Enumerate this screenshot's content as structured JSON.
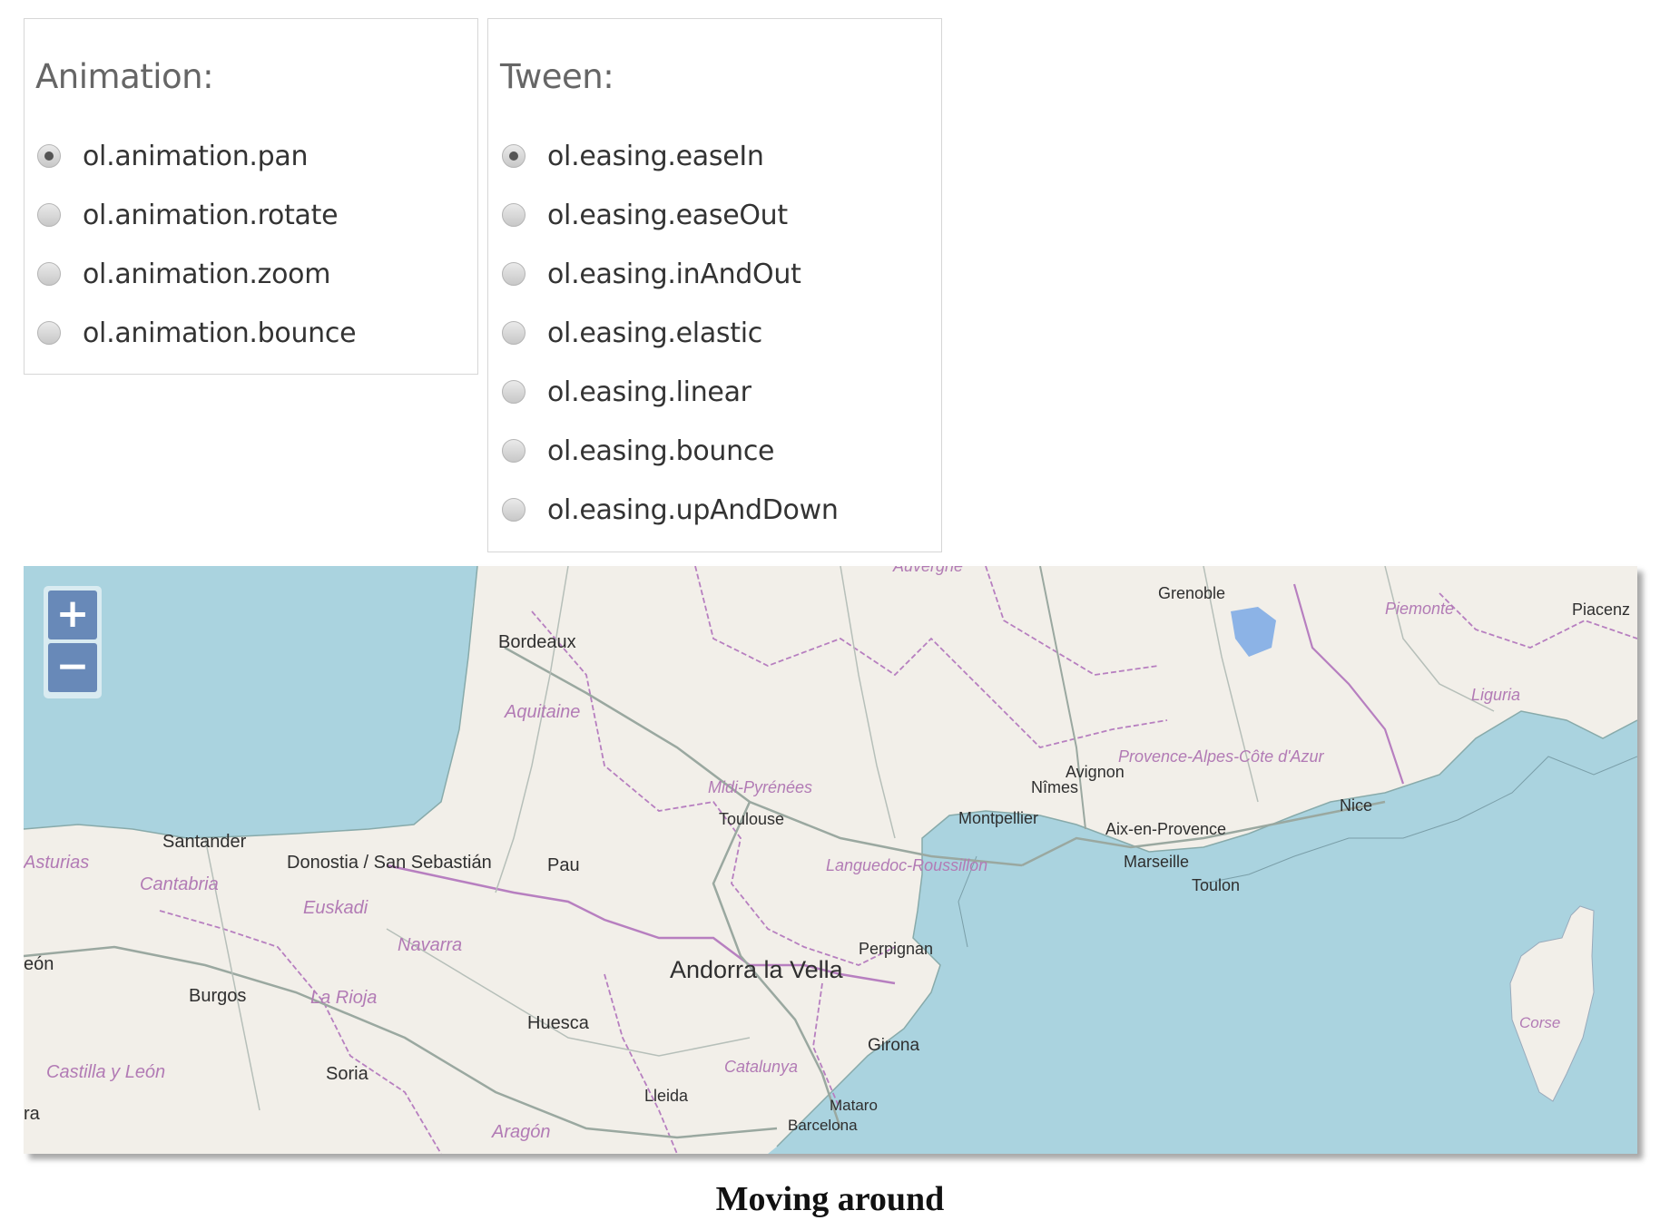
{
  "animation_panel": {
    "title": "Animation:",
    "options": [
      {
        "label": "ol.animation.pan",
        "selected": true
      },
      {
        "label": "ol.animation.rotate",
        "selected": false
      },
      {
        "label": "ol.animation.zoom",
        "selected": false
      },
      {
        "label": "ol.animation.bounce",
        "selected": false
      }
    ]
  },
  "tween_panel": {
    "title": "Tween:",
    "options": [
      {
        "label": "ol.easing.easeIn",
        "selected": true
      },
      {
        "label": "ol.easing.easeOut",
        "selected": false
      },
      {
        "label": "ol.easing.inAndOut",
        "selected": false
      },
      {
        "label": "ol.easing.elastic",
        "selected": false
      },
      {
        "label": "ol.easing.linear",
        "selected": false
      },
      {
        "label": "ol.easing.bounce",
        "selected": false
      },
      {
        "label": "ol.easing.upAndDown",
        "selected": false
      }
    ]
  },
  "map": {
    "zoom_in_label": "+",
    "zoom_out_label": "−",
    "colors": {
      "sea": "#aad3df",
      "land": "#f2efe9",
      "border": "#b77fc0"
    },
    "cities": {
      "grenoble": "Grenoble",
      "placenza": "Piacenz",
      "bordeaux": "Bordeaux",
      "avignon": "Avignon",
      "nimes": "Nîmes",
      "montpellier": "Montpellier",
      "nice": "Nice",
      "aix": "Aix-en-Provence",
      "marseille": "Marseille",
      "toulon": "Toulon",
      "toulouse": "Toulouse",
      "santander": "Santander",
      "donostia": "Donostia / San Sebastián",
      "pau": "Pau",
      "perpignan": "Perpignan",
      "andorra": "Andorra la Vella",
      "burgos": "Burgos",
      "huesca": "Huesca",
      "girona": "Girona",
      "soria": "Soria",
      "lleida": "Lleida",
      "mataro": "Mataro",
      "barcelona": "Barcelona",
      "leon": "eón",
      "ra": "ra"
    },
    "regions": {
      "auvergne": "Auvergne",
      "piemonte": "Piemonte",
      "liguria": "Liguria",
      "aquitaine": "Aquitaine",
      "paca": "Provence-Alpes-Côte d'Azur",
      "midipyr": "Midi-Pyrénées",
      "languedoc": "Languedoc-Roussillon",
      "asturias": "Asturias",
      "cantabria": "Cantabria",
      "euskadi": "Euskadi",
      "navarra": "Navarra",
      "larioja": "La Rioja",
      "catalunya": "Catalunya",
      "castilla": "Castilla y León",
      "aragon": "Aragón",
      "corse": "Corse"
    }
  },
  "caption": "Moving around"
}
